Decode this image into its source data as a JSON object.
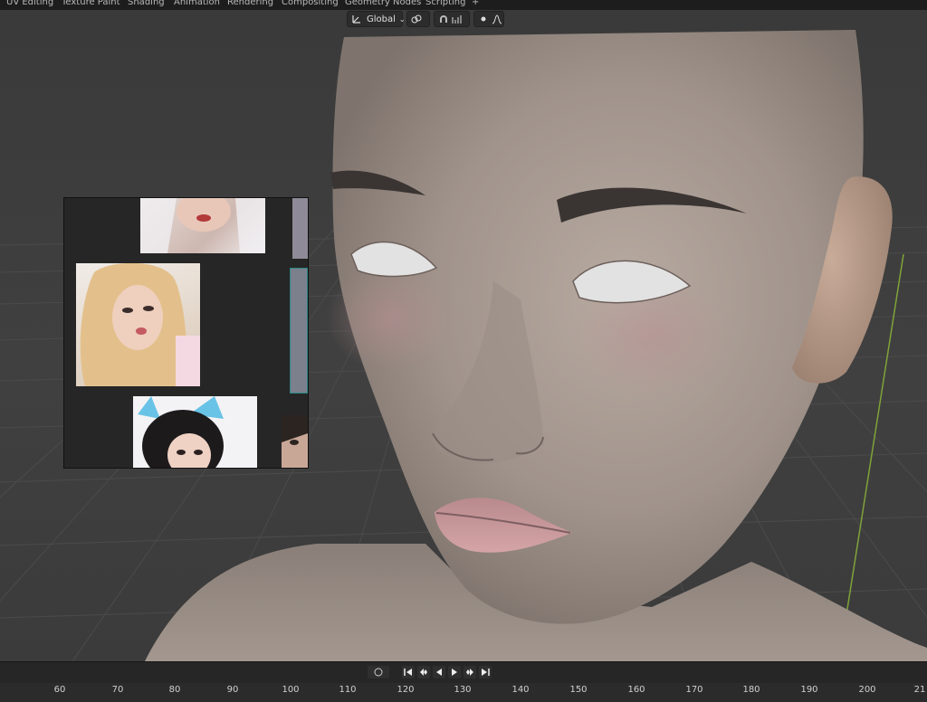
{
  "workspace_tabs": [
    "UV Editing",
    "Texture Paint",
    "Shading",
    "Animation",
    "Rendering",
    "Compositing",
    "Geometry Nodes",
    "Scripting",
    "+"
  ],
  "viewport_header": {
    "transform_orientation": "Global",
    "orientation_icon": "transform-orientation-icon",
    "pivot_icon": "link-icon",
    "snap_icon": "magnet-icon",
    "snap_target_icon": "snap-increment-icon",
    "proportional_icon": "proportional-edit-icon",
    "falloff_icon": "falloff-curve-icon"
  },
  "timeline": {
    "playback_icons": [
      "jump-start-icon",
      "keyframe-prev-icon",
      "play-reverse-icon",
      "play-icon",
      "keyframe-next-icon",
      "jump-end-icon"
    ],
    "ruler_ticks": [
      "60",
      "70",
      "80",
      "90",
      "100",
      "110",
      "120",
      "130",
      "140",
      "150",
      "160",
      "170",
      "180",
      "190",
      "200",
      "21"
    ]
  },
  "colors": {
    "ui_dark": "#1d1d1d",
    "viewport_bg": "#3d3d3d",
    "grid_line": "#4a4a4a",
    "y_axis": "#7fa33a",
    "skin": "#a79b93"
  }
}
